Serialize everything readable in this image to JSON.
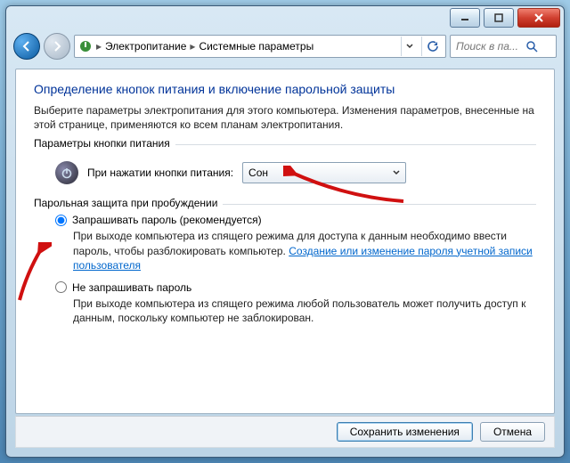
{
  "breadcrumb": {
    "level1": "Электропитание",
    "level2": "Системные параметры"
  },
  "search": {
    "placeholder": "Поиск в па..."
  },
  "page": {
    "title": "Определение кнопок питания и включение парольной защиты",
    "intro": "Выберите параметры электропитания для этого компьютера. Изменения параметров, внесенные на этой странице, применяются ко всем планам электропитания."
  },
  "group_power": {
    "legend": "Параметры кнопки питания",
    "press_label": "При нажатии кнопки питания:",
    "selected": "Сон"
  },
  "group_password": {
    "legend": "Парольная защита при пробуждении",
    "opt_require": {
      "label": "Запрашивать пароль (рекомендуется)",
      "desc_prefix": "При выходе компьютера из спящего режима для доступа к данным необходимо ввести пароль, чтобы разблокировать компьютер. ",
      "link": "Создание или изменение пароля учетной записи пользователя"
    },
    "opt_norequire": {
      "label": "Не запрашивать пароль",
      "desc": "При выходе компьютера из спящего режима любой пользователь может получить доступ к данным, поскольку компьютер не заблокирован."
    }
  },
  "buttons": {
    "save": "Сохранить изменения",
    "cancel": "Отмена"
  }
}
